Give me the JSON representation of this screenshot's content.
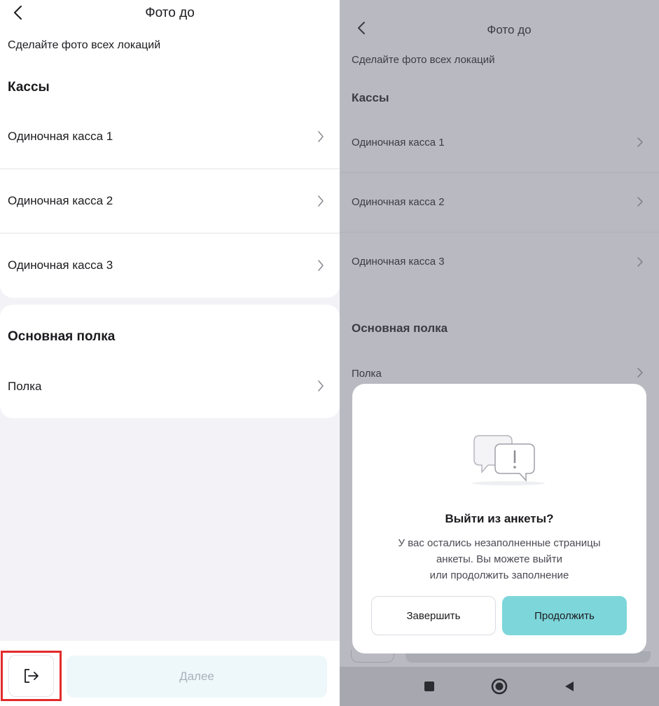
{
  "left": {
    "header": {
      "title": "Фото до"
    },
    "subtitle": "Сделайте фото всех локаций",
    "sections": [
      {
        "title": "Кассы",
        "items": [
          "Одиночная касса 1",
          "Одиночная касса 2",
          "Одиночная касса 3"
        ]
      },
      {
        "title": "Основная полка",
        "items": [
          "Полка"
        ]
      }
    ],
    "footer": {
      "next_label": "Далее"
    }
  },
  "right": {
    "header": {
      "title": "Фото до"
    },
    "subtitle": "Сделайте фото всех локаций",
    "sections": [
      {
        "title": "Кассы",
        "items": [
          "Одиночная касса 1",
          "Одиночная касса 2",
          "Одиночная касса 3"
        ]
      },
      {
        "title": "Основная полка",
        "items": [
          "Полка"
        ]
      }
    ],
    "dialog": {
      "title": "Выйти из анкеты?",
      "lines": [
        "У вас остались незаполненные страницы",
        "анкеты. Вы можете выйти",
        "или продолжить заполнение"
      ],
      "finish_label": "Завершить",
      "continue_label": "Продолжить"
    }
  },
  "icons": {
    "back": "chevron-left-icon",
    "row": "chevron-right-icon",
    "exit": "logout-icon",
    "dialog": "chat-alert-icon",
    "nav": [
      "square-icon",
      "circle-icon",
      "triangle-back-icon"
    ]
  },
  "colors": {
    "accent": "#7dd6da",
    "highlight": "#e32a2a",
    "next_disabled_bg": "#eef8fa",
    "overlay": "#b9bac1"
  }
}
